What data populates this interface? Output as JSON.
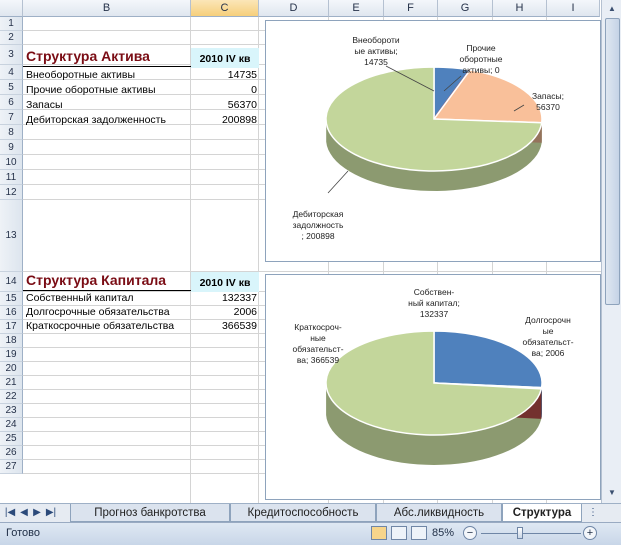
{
  "columns": [
    "B",
    "C",
    "D",
    "E",
    "F",
    "G",
    "H",
    "I"
  ],
  "rows": [
    "1",
    "2",
    "3",
    "4",
    "5",
    "6",
    "7",
    "8",
    "9",
    "10",
    "11",
    "12",
    "13",
    "14",
    "15",
    "16",
    "17",
    "18",
    "19",
    "20",
    "21",
    "22",
    "23",
    "24",
    "25",
    "26",
    "27"
  ],
  "assets": {
    "title": "Структура Актива",
    "period": "2010 IV кв",
    "items": [
      {
        "label": "Внеоборотные активы",
        "value": "14735"
      },
      {
        "label": "Прочие оборотные активы",
        "value": "0"
      },
      {
        "label": "Запасы",
        "value": "56370"
      },
      {
        "label": "Дебиторская задолженность",
        "value": "200898"
      }
    ]
  },
  "capital": {
    "title": "Структура Капитала",
    "period": "2010 IV кв",
    "items": [
      {
        "label": "Собственный капитал",
        "value": "132337"
      },
      {
        "label": "Долгосрочные обязательства",
        "value": "2006"
      },
      {
        "label": "Краткосрочные обязательства",
        "value": "366539"
      }
    ]
  },
  "chart_data": [
    {
      "type": "pie",
      "categories": [
        "Внеоборотные активы",
        "Прочие оборотные активы",
        "Запасы",
        "Дебиторская задолженность"
      ],
      "values": [
        14735,
        0,
        56370,
        200898
      ],
      "colors": [
        "#4f81bd",
        "#c0504d",
        "#f9c09a",
        "#c3d69b"
      ],
      "labels": [
        [
          "Внеобороти",
          "ые активы;",
          "14735"
        ],
        [
          "Прочие",
          "оборотные",
          "активы; 0"
        ],
        [
          "Запасы;",
          "56370"
        ],
        [
          "Дебиторская",
          "задолжность",
          "; 200898"
        ]
      ]
    },
    {
      "type": "pie",
      "categories": [
        "Собственный капитал",
        "Долгосрочные обязательства",
        "Краткосрочные обязательства"
      ],
      "values": [
        132337,
        2006,
        366539
      ],
      "colors": [
        "#4f81bd",
        "#c0504d",
        "#c3d69b"
      ],
      "labels": [
        [
          "Собствен-",
          "ный капитал;",
          "132337"
        ],
        [
          "Долгосрочн",
          "ые",
          "обязательст-",
          "ва; 2006"
        ],
        [
          "Краткосроч-",
          "ные",
          "обязательст-",
          "ва; 366539"
        ]
      ]
    }
  ],
  "tabs": [
    "Прогноз банкротства",
    "Кредитоспособность",
    "Абс.ликвидность",
    "Структура"
  ],
  "status": {
    "ready": "Готово",
    "zoom": "85%"
  },
  "colors": {
    "title": "#7a0c14",
    "header_fill": "#d9f5fb",
    "grid": "#d4d4d4"
  },
  "icons": [
    "tab-first-icon",
    "tab-prev-icon",
    "tab-next-icon",
    "tab-last-icon",
    "normal-view-icon",
    "page-layout-icon",
    "page-break-icon",
    "zoom-out-icon",
    "zoom-in-icon",
    "zoom-slider"
  ]
}
